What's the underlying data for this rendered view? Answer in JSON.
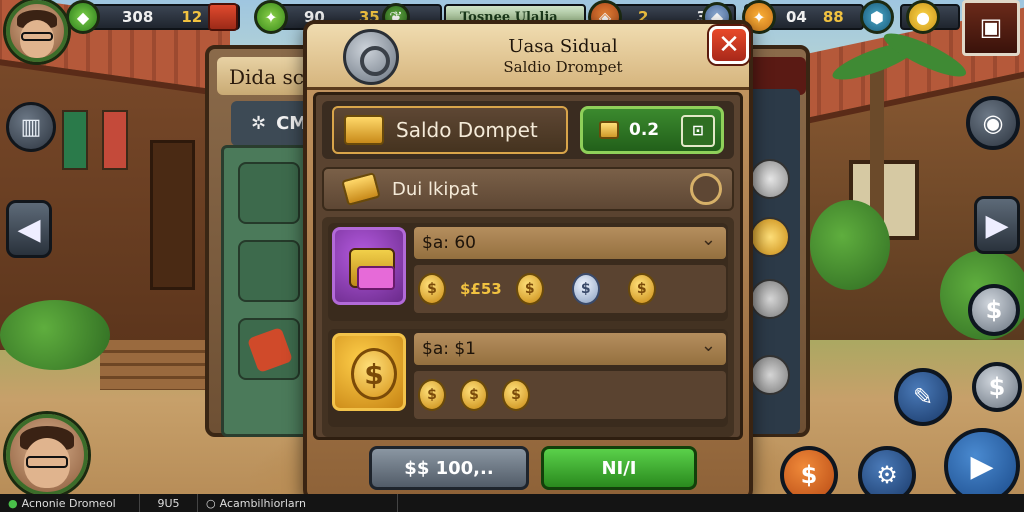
{
  "hud": {
    "bar1_value": "308",
    "bar1_extra": "12",
    "bar2_value": "90",
    "bar2_extra": "35",
    "bar3_label": "Tosnee Ulalia",
    "bar4_value": "2",
    "bar4_extra": "3",
    "bar5_value": "04",
    "bar5_extra": "88"
  },
  "back_panel": {
    "title": "Dida sc",
    "tab_label": "CM"
  },
  "dialog": {
    "title_main": "Uasa Sidual",
    "title_sub": "Saldio Drompet",
    "close_label": "✕",
    "wallet": {
      "label": "Saldo Dompet",
      "balance": "0.2",
      "slot_label": "⊡"
    },
    "section": {
      "label": "Dui lkipat"
    },
    "offers": [
      {
        "header": "$a: 60",
        "coins_text": "$£53",
        "coin_symbols": [
          "$",
          "$",
          "$",
          "$"
        ]
      },
      {
        "header": "$a: $1",
        "coin_symbols": [
          "$",
          "$",
          "$"
        ]
      }
    ],
    "footer": {
      "price_label": "$$ 100,..",
      "confirm_label": "NI/I"
    }
  },
  "status_bar": {
    "left": "Acnonie Dromeol",
    "middle": "9U5",
    "right": "Acambilhiorlarn"
  },
  "colors": {
    "dialog_bg": "#c89a64",
    "accent_green": "#3b8a2e",
    "close_red": "#e84a2a",
    "gold": "#f1c240"
  }
}
